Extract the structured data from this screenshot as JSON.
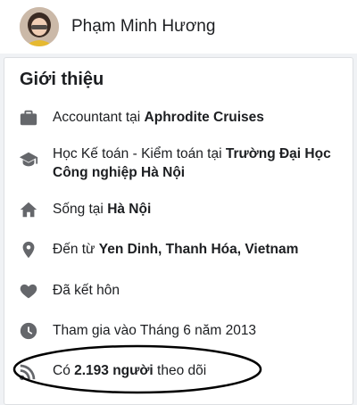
{
  "header": {
    "name": "Phạm Minh Hương"
  },
  "intro": {
    "title": "Giới thiệu",
    "items": [
      {
        "icon": "briefcase-icon",
        "prefix": "Accountant tại ",
        "bold": "Aphrodite Cruises"
      },
      {
        "icon": "graduation-cap-icon",
        "prefix": "Học Kế toán - Kiểm toán tại ",
        "bold": "Trường Đại Học Công nghiệp Hà Nội"
      },
      {
        "icon": "home-icon",
        "prefix": "Sống tại ",
        "bold": "Hà Nội"
      },
      {
        "icon": "location-pin-icon",
        "prefix": "Đến từ ",
        "bold": "Yen Dinh, Thanh Hóa, Vietnam"
      },
      {
        "icon": "heart-icon",
        "prefix": "Đã kết hôn",
        "bold": ""
      },
      {
        "icon": "clock-icon",
        "prefix": "Tham gia vào Tháng 6 năm 2013",
        "bold": ""
      },
      {
        "icon": "follower-feed-icon",
        "prefix": "Có ",
        "bold": "2.193 người",
        "suffix": " theo dõi"
      }
    ]
  },
  "colors": {
    "icon": "#65676b",
    "annotation": "#000000"
  }
}
